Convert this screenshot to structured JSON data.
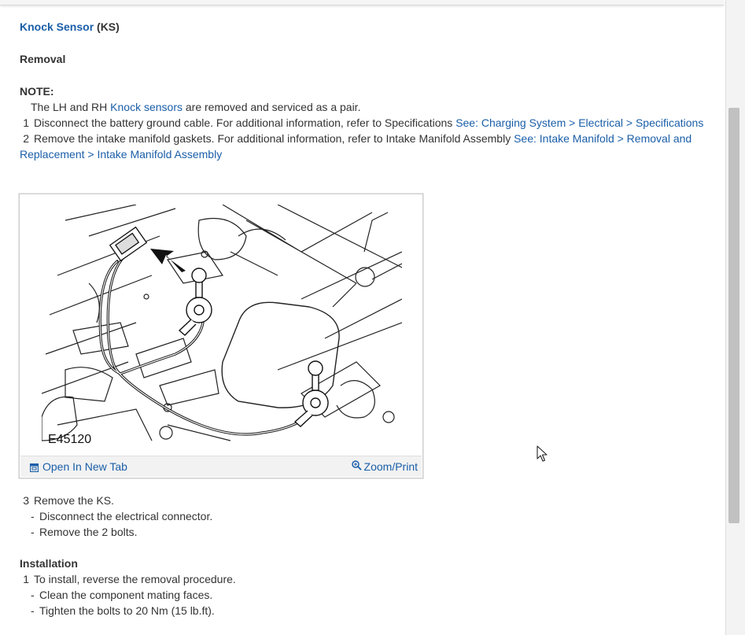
{
  "header": {
    "title_link": "Knock Sensor",
    "title_suffix": " (KS)",
    "section_removal": "Removal"
  },
  "note": {
    "label": "NOTE:",
    "text_before": "The LH and RH ",
    "link": "Knock sensors",
    "text_after": " are removed and serviced as a pair."
  },
  "removal_steps": [
    {
      "num": "1",
      "text": "Disconnect the battery ground cable. For additional information, refer to Specifications ",
      "link": "See: Charging System > Electrical > Specifications"
    },
    {
      "num": "2",
      "text": "Remove the intake manifold gaskets. For additional information, refer to Intake Manifold Assembly ",
      "link": "See: Intake Manifold > Removal and Replacement > Intake Manifold Assembly"
    }
  ],
  "figure": {
    "code": "E45120",
    "open_new_tab": "Open In New Tab",
    "zoom_print": "Zoom/Print"
  },
  "step3": {
    "num": "3",
    "text": "Remove the KS.",
    "subs": [
      "Disconnect the electrical connector.",
      "Remove the 2 bolts."
    ]
  },
  "installation": {
    "title": "Installation",
    "num": "1",
    "text": "To install, reverse the removal procedure.",
    "subs": [
      "Clean the component mating faces.",
      "Tighten the bolts to 20 Nm (15 lb.ft)."
    ]
  },
  "icons": [
    "open-new-tab-icon",
    "zoom-icon",
    "mouse-cursor-icon"
  ]
}
